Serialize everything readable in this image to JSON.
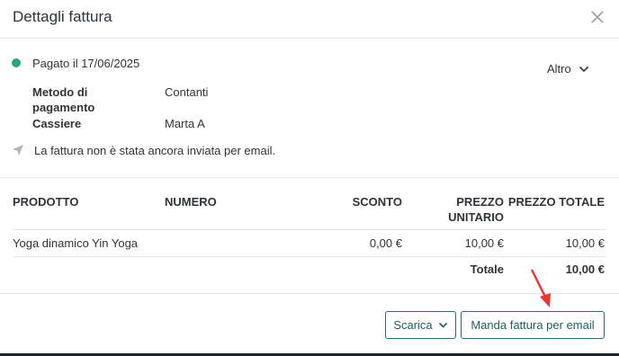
{
  "header": {
    "title": "Dettagli fattura"
  },
  "status": {
    "text": "Pagato il 17/06/2025",
    "color": "#2aa676"
  },
  "menu": {
    "altro_label": "Altro"
  },
  "details": {
    "metodo_label": "Metodo di pagamento",
    "metodo_value": "Contanti",
    "cassiere_label": "Cassiere",
    "cassiere_value": "Marta A"
  },
  "email_notice": "La fattura non è stata ancora inviata per email.",
  "table": {
    "headers": {
      "prodotto": "PRODOTTO",
      "numero": "NUMERO",
      "sconto": "SCONTO",
      "prezzo_unitario": "PREZZO UNITARIO",
      "prezzo_totale": "PREZZO TOTALE"
    },
    "rows": [
      {
        "prodotto": "Yoga dinamico Yin Yoga",
        "numero": "",
        "sconto": "0,00 €",
        "prezzo_unitario": "10,00 €",
        "prezzo_totale": "10,00 €"
      }
    ],
    "totale_label": "Totale",
    "totale_value": "10,00 €"
  },
  "footer": {
    "scarica_label": "Scarica",
    "email_button_label": "Manda fattura per email"
  },
  "icons": {
    "close": "close-icon",
    "chevron": "chevron-down-icon",
    "send": "send-icon",
    "annotation": "arrow-annotation"
  },
  "colors": {
    "accent": "#1f6f6f",
    "annotation_arrow": "#e53935"
  }
}
